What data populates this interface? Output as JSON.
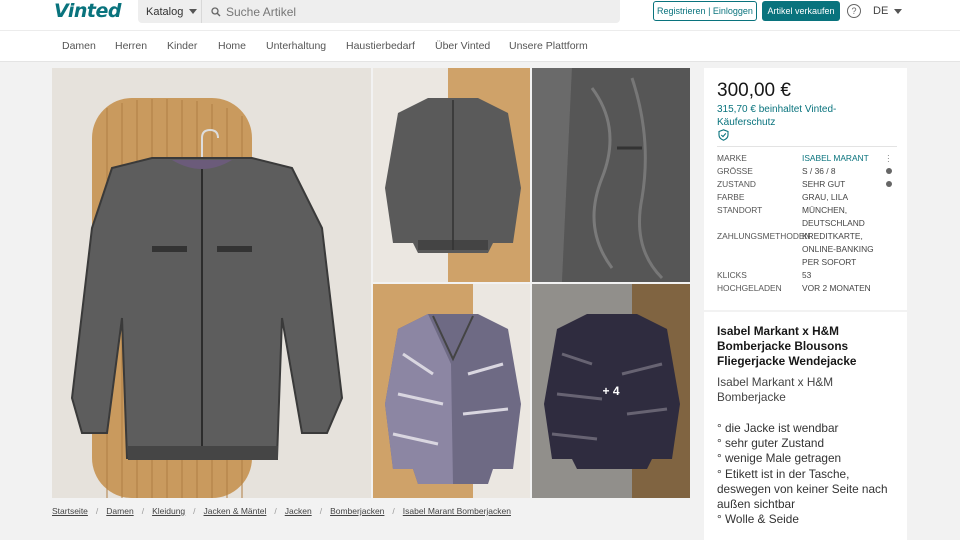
{
  "brand": {
    "logo": "Vinted",
    "accent": "#09737d"
  },
  "header": {
    "catalog_label": "Katalog",
    "search_placeholder": "Suche Artikel",
    "register_login_label": "Registrieren | Einloggen",
    "sell_label": "Artikel verkaufen",
    "help_icon": "question-circle-icon",
    "language": "DE"
  },
  "nav": {
    "items": [
      "Damen",
      "Herren",
      "Kinder",
      "Home",
      "Unterhaltung",
      "Haustierbedarf",
      "Über Vinted",
      "Unsere Plattform"
    ]
  },
  "gallery": {
    "more_label": "+ 4"
  },
  "breadcrumb": [
    "Startseite",
    "Damen",
    "Kleidung",
    "Jacken & Mäntel",
    "Jacken",
    "Bomberjacken",
    "Isabel Marant Bomberjacken"
  ],
  "listing": {
    "price": "300,00 €",
    "price_incl_protection": "315,70 € beinhaltet Vinted-Käuferschutz",
    "details": [
      {
        "key": "MARKE",
        "value": "ISABEL MARANT"
      },
      {
        "key": "GRÖSSE",
        "value": "S / 36 / 8"
      },
      {
        "key": "ZUSTAND",
        "value": "SEHR GUT"
      },
      {
        "key": "FARBE",
        "value": "GRAU, LILA"
      },
      {
        "key": "STANDORT",
        "value": "MÜNCHEN, DEUTSCHLAND"
      },
      {
        "key": "ZAHLUNGSMETHODEN",
        "value": "KREDITKARTE, ONLINE-BANKING PER SOFORT"
      },
      {
        "key": "KLICKS",
        "value": "53"
      },
      {
        "key": "HOCHGELADEN",
        "value": "VOR 2 MONATEN"
      }
    ],
    "title": "Isabel Markant x H&M Bomberjacke Blousons Fliegerjacke Wendejacke",
    "subtitle": "Isabel Markant x H&M Bomberjacke",
    "description": [
      "° die Jacke ist wendbar",
      "° sehr guter Zustand",
      "° wenige Male getragen",
      "° Etikett ist in der Tasche, deswegen von keiner Seite nach außen sichtbar",
      "° Wolle & Seide"
    ]
  }
}
